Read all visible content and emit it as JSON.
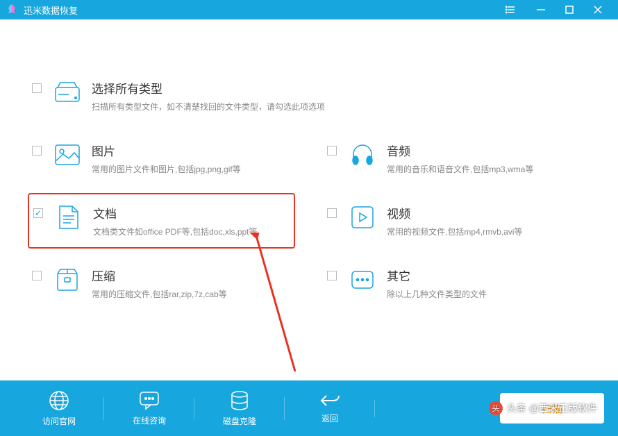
{
  "app": {
    "title": "迅米数据恢复"
  },
  "options": {
    "all": {
      "title": "选择所有类型",
      "desc": "扫描所有类型文件，如不清楚找回的文件类型，请勾选此项选项",
      "checked": false
    },
    "image": {
      "title": "图片",
      "desc": "常用的图片文件和图片,包括jpg,png,gif等",
      "checked": false
    },
    "audio": {
      "title": "音频",
      "desc": "常用的音乐和语音文件,包括mp3,wma等",
      "checked": false
    },
    "document": {
      "title": "文档",
      "desc": "文档类文件如office PDF等,包括doc,xls,ppt等",
      "checked": true
    },
    "video": {
      "title": "视频",
      "desc": "常用的视频文件,包括mp4,rmvb,avi等",
      "checked": false
    },
    "archive": {
      "title": "压缩",
      "desc": "常用的压缩文件,包括rar,zip,7z,cab等",
      "checked": false
    },
    "other": {
      "title": "其它",
      "desc": "除以上几种文件类型的文件",
      "checked": false
    }
  },
  "bottom": {
    "website": "访问官网",
    "chat": "在线咨询",
    "clone": "磁盘克隆",
    "back": "返回",
    "scan": "扫描"
  },
  "watermark": "头条 @西米正版软件"
}
